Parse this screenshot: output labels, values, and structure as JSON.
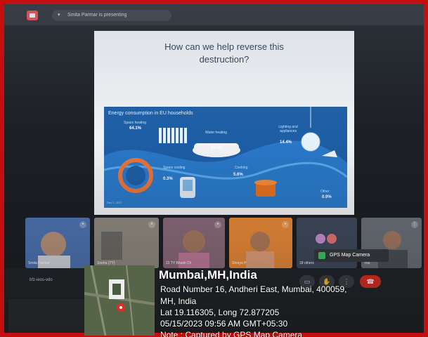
{
  "meet": {
    "presenting_text": "Smita Parmar is presenting",
    "meeting_code": "bfz-ieos-vdo",
    "gps_badge_label": "GPS Map Camera",
    "icons": [
      "camera-icon",
      "hand-icon",
      "more-icon",
      "end-call-icon",
      "chevron-down-icon"
    ]
  },
  "slide": {
    "title_line1": "How can we help reverse this",
    "title_line2": "destruction?",
    "infographic": {
      "title": "Energy consumption in EU households",
      "date": "Dec 2, 2017",
      "items": [
        {
          "label": "Space heating",
          "value": "64.1%"
        },
        {
          "label": "Water heating",
          "value": "14.8%"
        },
        {
          "label": "Lighting and appliances",
          "value": "14.4%"
        },
        {
          "label": "Space cooling",
          "value": "0.3%"
        },
        {
          "label": "Cooking",
          "value": "5.6%"
        },
        {
          "label": "Other",
          "value": "0.9%"
        }
      ]
    }
  },
  "participants": [
    {
      "name": "Smita Parmar",
      "color": "#5c86c9"
    },
    {
      "name": "Sneha (TY)",
      "color": "#7a8088"
    },
    {
      "name": "22 TY Bhakti Ch",
      "color": "#8a6a7a"
    },
    {
      "name": "Shreya P",
      "color": "#e98a3a"
    },
    {
      "name": "18 others",
      "color": "#3f4a5c"
    },
    {
      "name": "You",
      "color": "#6a7078"
    }
  ],
  "gps": {
    "city": "Mumbai,MH,India",
    "address_line1": "Road Number 16, Andheri East, Mumbai, 400059,",
    "address_line2": "MH, India",
    "coords": "Lat 19.116305, Long 72.877205",
    "datetime": "05/15/2023 09:56 AM GMT+05:30",
    "note": "Note : Captured by GPS Map Camera"
  }
}
